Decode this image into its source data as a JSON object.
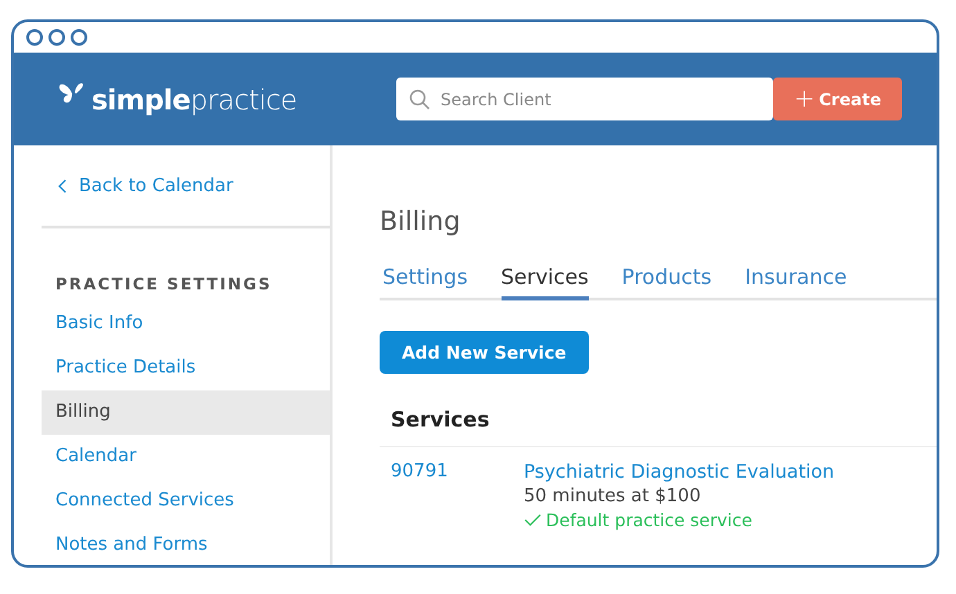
{
  "logo": {
    "text": "**simple**practice"
  },
  "search": {
    "placeholder": "Search Client"
  },
  "create_button": {
    "icon": "+",
    "label": "Create"
  },
  "sidebar": {
    "back_link": "Back to Calendar",
    "section_title": "PRACTICE SETTINGS",
    "items": [
      {
        "label": "Basic Info",
        "selected": false
      },
      {
        "label": "Practice Details",
        "selected": false
      },
      {
        "label": "Billing",
        "selected": true
      },
      {
        "label": "Calendar",
        "selected": false
      },
      {
        "label": "Connected Services",
        "selected": false
      },
      {
        "label": "Notes and Forms",
        "selected": false
      }
    ]
  },
  "page_title": "Billing",
  "tabs": [
    {
      "label": "Settings",
      "selected": false
    },
    {
      "label": "Services",
      "selected": true
    },
    {
      "label": "Products",
      "selected": false
    },
    {
      "label": "Insurance",
      "selected": false
    }
  ],
  "add_button": "Add New Service",
  "services": {
    "heading": "Services",
    "rows": [
      {
        "code": "90791",
        "name": "Psychiatric Diagnostic Evaluation",
        "detail": "50 minutes at $100",
        "default_label": "Default practice service",
        "default": true
      }
    ]
  }
}
